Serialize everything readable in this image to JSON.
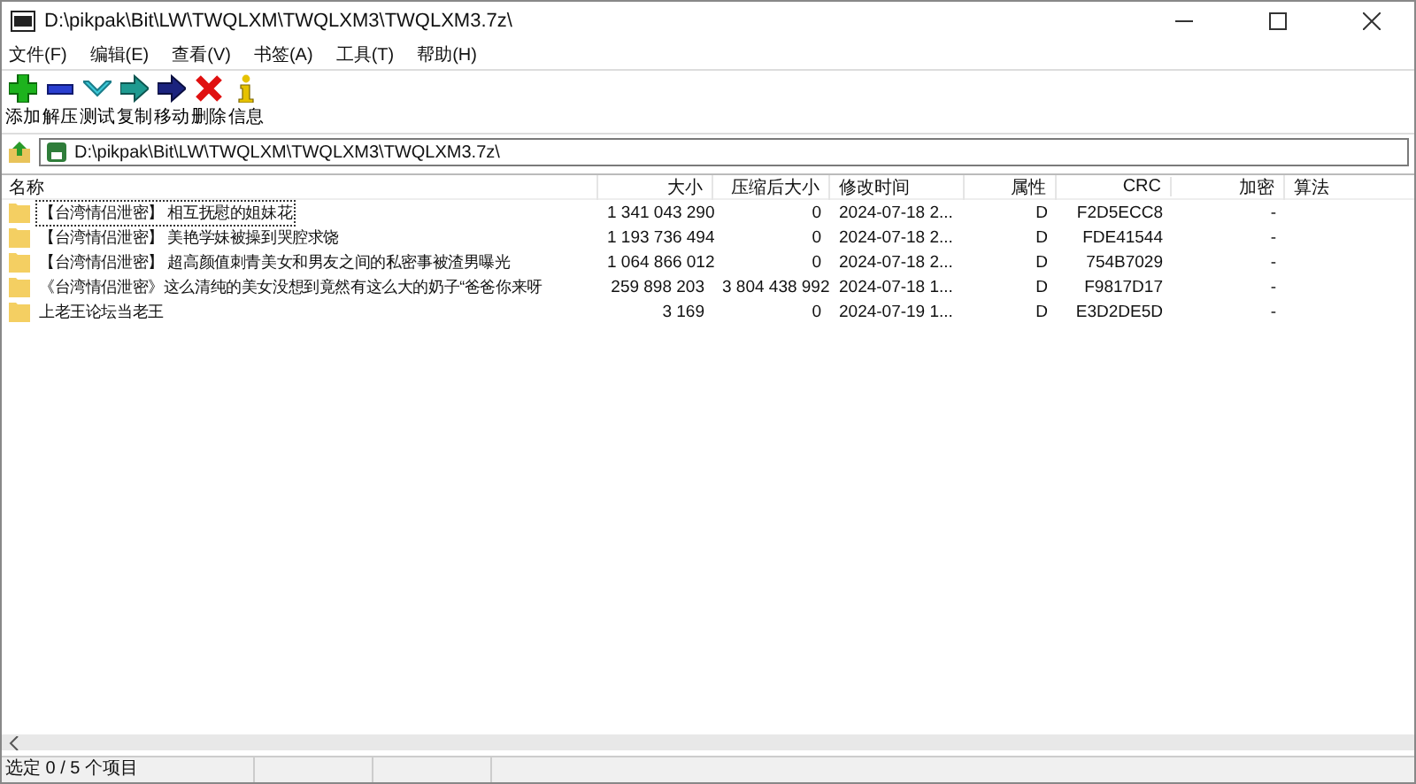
{
  "window": {
    "title": "D:\\pikpak\\Bit\\LW\\TWQLXM\\TWQLXM3\\TWQLXM3.7z\\"
  },
  "menu": [
    "文件(F)",
    "编辑(E)",
    "查看(V)",
    "书签(A)",
    "工具(T)",
    "帮助(H)"
  ],
  "toolbar": [
    {
      "kind": "add",
      "label": "添加"
    },
    {
      "kind": "extract",
      "label": "解压"
    },
    {
      "kind": "test",
      "label": "测试"
    },
    {
      "kind": "copy",
      "label": "复制"
    },
    {
      "kind": "move",
      "label": "移动"
    },
    {
      "kind": "delete",
      "label": "删除"
    },
    {
      "kind": "info",
      "label": "信息"
    }
  ],
  "address": {
    "value": "D:\\pikpak\\Bit\\LW\\TWQLXM\\TWQLXM3\\TWQLXM3.7z\\"
  },
  "table": {
    "columns": [
      "名称",
      "大小",
      "压缩后大小",
      "修改时间",
      "属性",
      "CRC",
      "加密",
      "算法"
    ],
    "rows": [
      {
        "selected": false,
        "focused": true,
        "cells": [
          "【台湾情侣泄密】 相互抚慰的姐妹花",
          "1 341 043 290",
          "0",
          "2024-07-18 2...",
          "D",
          "F2D5ECC8",
          "-"
        ]
      },
      {
        "selected": false,
        "focused": false,
        "cells": [
          "【台湾情侣泄密】 美艳学妹被操到哭腔求饶",
          "1 193 736 494",
          "0",
          "2024-07-18 2...",
          "D",
          "FDE41544",
          "-"
        ]
      },
      {
        "selected": false,
        "focused": false,
        "cells": [
          "【台湾情侣泄密】  超高颜值刺青美女和男友之间的私密事被渣男曝光",
          "1 064 866 012",
          "0",
          "2024-07-18 2...",
          "D",
          "754B7029",
          "-"
        ]
      },
      {
        "selected": false,
        "focused": false,
        "cells": [
          "《台湾情侣泄密》这么清纯的美女没想到竟然有这么大的奶子“爸爸你来呀",
          "259 898 203",
          "3 804 438 992",
          "2024-07-18 1...",
          "D",
          "F9817D17",
          "-"
        ]
      },
      {
        "selected": false,
        "focused": false,
        "cells": [
          "上老王论坛当老王",
          "3 169",
          "0",
          "2024-07-19 1...",
          "D",
          "E3D2DE5D",
          "-"
        ]
      }
    ]
  },
  "status_bar": {
    "text": "选定 0 / 5 个项目"
  }
}
